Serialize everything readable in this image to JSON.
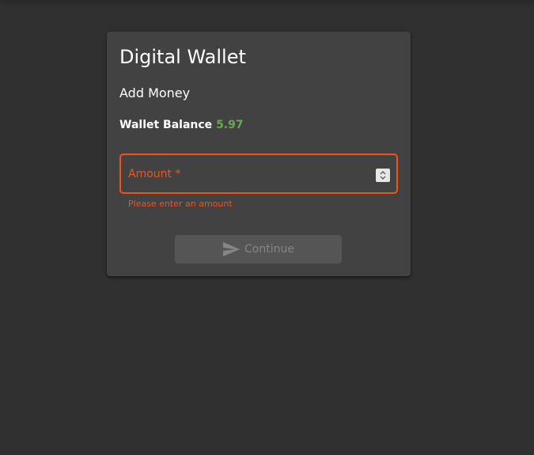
{
  "card": {
    "title": "Digital Wallet",
    "subtitle": "Add Money",
    "balance_label": "Wallet Balance",
    "balance_value": "5.97"
  },
  "amount_field": {
    "label": "Amount *",
    "value": "",
    "error": "Please enter an amount",
    "spinner_icon": "up-down-spinner-icon"
  },
  "continue_button": {
    "label": "Continue",
    "icon": "send-icon",
    "enabled": false
  },
  "colors": {
    "page_background": "#303030",
    "card_background": "#424242",
    "error_accent": "#f4511e",
    "balance_value": "#6aa84f",
    "button_disabled_bg": "#555555",
    "button_disabled_text": "#868686"
  }
}
